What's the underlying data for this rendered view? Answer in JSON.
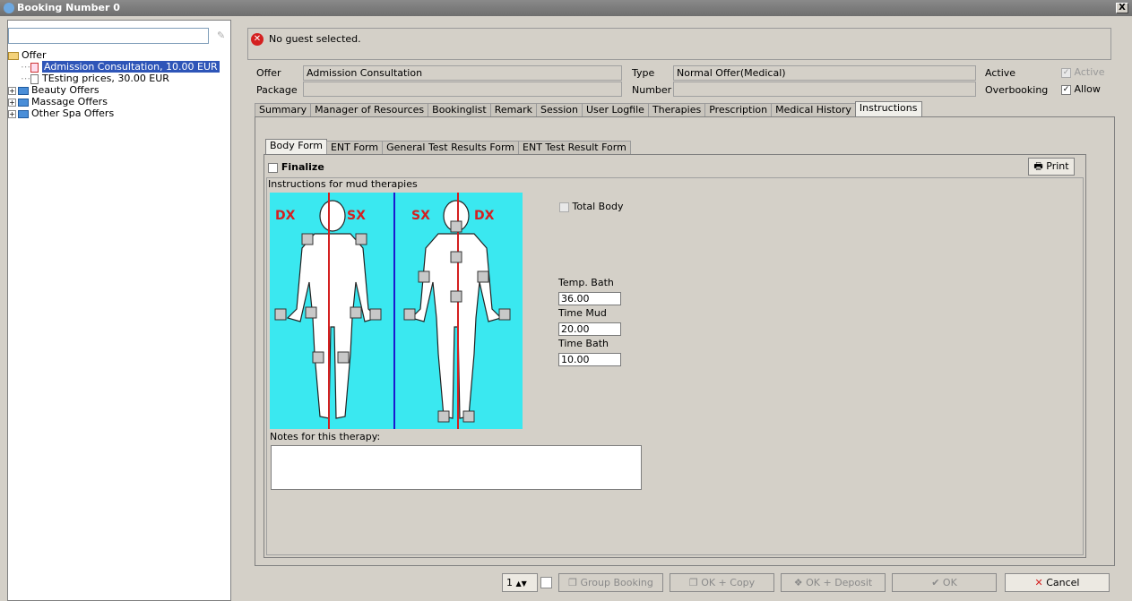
{
  "window": {
    "title": "Booking Number 0",
    "close": "X"
  },
  "tree": {
    "root": "Offer",
    "items": [
      {
        "label": "Admission Consultation, 10.00 EUR"
      },
      {
        "label": "TEsting prices, 30.00 EUR"
      }
    ],
    "groups": [
      "Beauty Offers",
      "Massage Offers",
      "Other Spa Offers"
    ]
  },
  "message": "No guest selected.",
  "info": {
    "offer_label": "Offer",
    "offer_value": "Admission Consultation",
    "package_label": "Package",
    "package_value": "",
    "type_label": "Type",
    "type_value": "Normal Offer(Medical)",
    "number_label": "Number",
    "number_value": "",
    "active_label": "Active",
    "active_cb": "Active",
    "overbooking_label": "Overbooking",
    "allow_cb": "Allow"
  },
  "tabs": [
    "Summary",
    "Manager of Resources",
    "Bookinglist",
    "Remark",
    "Session",
    "User Logfile",
    "Therapies",
    "Prescription",
    "Medical History",
    "Instructions"
  ],
  "subtabs": [
    "Body Form",
    "ENT Form",
    "General Test Results Form",
    "ENT Test Result Form"
  ],
  "form": {
    "finalize": "Finalize",
    "print": "Print",
    "instructions_label": "Instructions for mud therapies",
    "body_labels": {
      "dx": "DX",
      "sx": "SX"
    },
    "total_body": "Total Body",
    "temp_bath_label": "Temp. Bath",
    "temp_bath_value": "36.00",
    "time_mud_label": "Time Mud",
    "time_mud_value": "20.00",
    "time_bath_label": "Time Bath",
    "time_bath_value": "10.00",
    "notes_label": "Notes for this therapy:"
  },
  "footer": {
    "count": "1",
    "group_booking": "Group Booking",
    "ok_copy": "OK + Copy",
    "ok_deposit": "OK + Deposit",
    "ok": "OK",
    "cancel": "Cancel"
  },
  "colors": {
    "accent": "#2e55b8",
    "body_bg": "#3ae8f0",
    "marker_red": "#d42020"
  }
}
